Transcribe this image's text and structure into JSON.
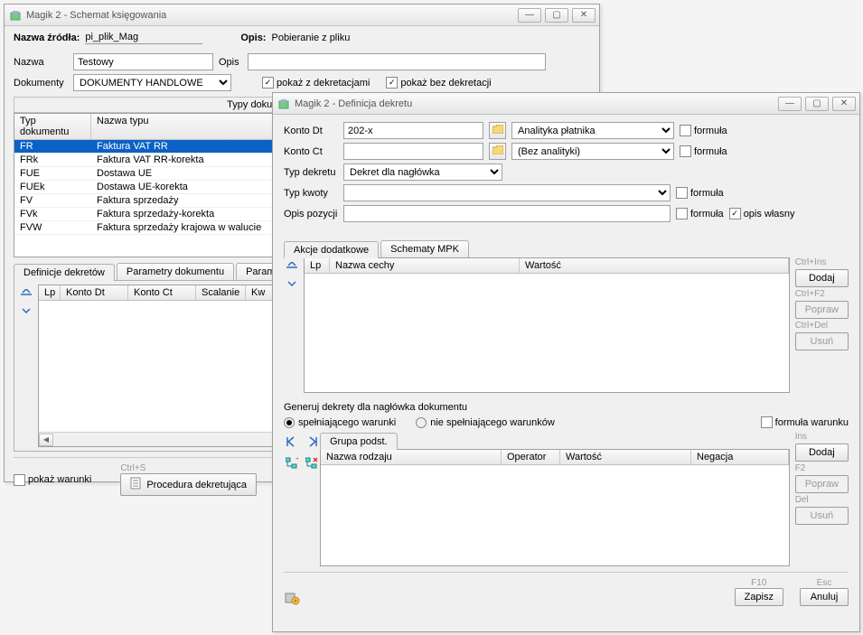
{
  "win1": {
    "title": "Magik 2 - Schemat księgowania",
    "nazwa_zrodla_label": "Nazwa źródła:",
    "nazwa_zrodla_value": "pi_plik_Mag",
    "opis_label": "Opis:",
    "opis_value": "Pobieranie z pliku",
    "nazwa_label": "Nazwa",
    "nazwa_input": "Testowy",
    "opis2_label": "Opis",
    "opis2_input": "",
    "dokumenty_label": "Dokumenty",
    "dokumenty_select": "DOKUMENTY HANDLOWE",
    "chk_z_dekr": "pokaż z dekretacjami",
    "chk_bez_dekr": "pokaż bez dekretacji",
    "typy_header": "Typy dokumentów importowanych",
    "col_typ": "Typ dokumentu",
    "col_nazwa": "Nazwa typu",
    "doc_types": [
      {
        "typ": "FR",
        "nazwa": "Faktura VAT RR"
      },
      {
        "typ": "FRk",
        "nazwa": "Faktura VAT RR-korekta"
      },
      {
        "typ": "FUE",
        "nazwa": "Dostawa UE"
      },
      {
        "typ": "FUEk",
        "nazwa": "Dostawa UE-korekta"
      },
      {
        "typ": "FV",
        "nazwa": "Faktura sprzedaży"
      },
      {
        "typ": "FVk",
        "nazwa": "Faktura sprzedaży-korekta"
      },
      {
        "typ": "FVW",
        "nazwa": "Faktura sprzedaży krajowa w walucie"
      }
    ],
    "tab_def": "Definicje dekretów",
    "tab_param_dok": "Parametry dokumentu",
    "tab_param_v": "Parametry V",
    "col_lp": "Lp",
    "col_konto_dt": "Konto Dt",
    "col_konto_ct": "Konto Ct",
    "col_scalanie": "Scalanie",
    "col_kw": "Kw",
    "chk_pokaz_warunki": "pokaż warunki",
    "ctrl_s": "Ctrl+S",
    "btn_procedura": "Procedura dekretująca"
  },
  "win2": {
    "title": "Magik 2  - Definicja dekretu",
    "konto_dt_label": "Konto Dt",
    "konto_dt_value": "202-x",
    "konto_dt_analityka": "Analityka płatnika",
    "konto_ct_label": "Konto Ct",
    "konto_ct_value": "",
    "konto_ct_analityka": "(Bez analityki)",
    "formula": "formuła",
    "typ_dekretu_label": "Typ dekretu",
    "typ_dekretu_value": "Dekret dla nagłówka",
    "typ_kwoty_label": "Typ kwoty",
    "typ_kwoty_value": "",
    "opis_pozycji_label": "Opis pozycji",
    "opis_pozycji_value": "",
    "opis_wlasny": "opis własny",
    "tab_akcje": "Akcje dodatkowe",
    "tab_schematy": "Schematy MPK",
    "col_lp": "Lp",
    "col_nazwa_cechy": "Nazwa cechy",
    "col_wartosc": "Wartość",
    "sc_ctrl_ins": "Ctrl+Ins",
    "btn_dodaj": "Dodaj",
    "sc_ctrl_f2": "Ctrl+F2",
    "btn_popraw": "Popraw",
    "sc_ctrl_del": "Ctrl+Del",
    "btn_usun": "Usuń",
    "generuj_label": "Generuj dekrety dla nagłówka dokumentu",
    "radio_spelnia": "spełniającego warunki",
    "radio_nie": "nie spełniającego warunków",
    "formula_warunku": "formuła warunku",
    "tab_grupa": "Grupa podst.",
    "col_nazwa_rodzaju": "Nazwa rodzaju",
    "col_operator": "Operator",
    "col_wartosc2": "Wartość",
    "col_negacja": "Negacja",
    "sc_ins": "Ins",
    "sc_f2": "F2",
    "sc_del": "Del",
    "sc_f10": "F10",
    "btn_zapisz": "Zapisz",
    "sc_esc": "Esc",
    "btn_anuluj": "Anuluj"
  }
}
